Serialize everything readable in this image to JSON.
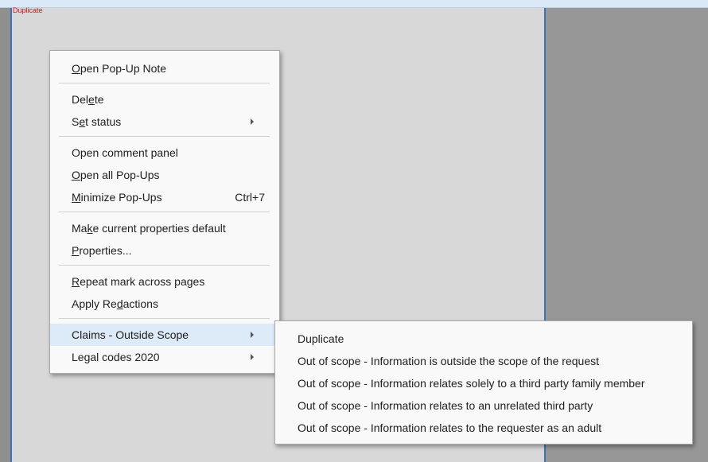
{
  "stamp_label": "Duplicate",
  "context_menu": {
    "items": [
      {
        "pre": "",
        "ul": "O",
        "post": "pen Pop-Up Note"
      },
      {
        "pre": "Del",
        "ul": "e",
        "post": "te"
      },
      {
        "pre": "S",
        "ul": "e",
        "post": "t status"
      },
      {
        "pre": "Open comment panel",
        "ul": "",
        "post": ""
      },
      {
        "pre": "",
        "ul": "O",
        "post": "pen all Pop-Ups"
      },
      {
        "pre": "",
        "ul": "M",
        "post": "inimize Pop-Ups",
        "shortcut": "Ctrl+7"
      },
      {
        "pre": "Ma",
        "ul": "k",
        "post": "e current properties default"
      },
      {
        "pre": "",
        "ul": "P",
        "post": "roperties..."
      },
      {
        "pre": "",
        "ul": "R",
        "post": "epeat mark across pages"
      },
      {
        "pre": "Apply Re",
        "ul": "d",
        "post": "actions"
      },
      {
        "pre": "Claims - Outside Scope",
        "ul": "",
        "post": ""
      },
      {
        "pre": "Legal codes 2020",
        "ul": "",
        "post": ""
      }
    ]
  },
  "submenu": {
    "items": [
      "Duplicate",
      "Out of scope - Information is outside the scope of the request",
      "Out of scope - Information relates solely to a third party family member",
      "Out of scope - Information relates to an unrelated third party",
      "Out of scope - Information relates to the requester as an adult"
    ]
  },
  "colors": {
    "highlight": "#ddeaf7",
    "page_border": "#3a73b8",
    "stamp_text": "#e01010"
  }
}
